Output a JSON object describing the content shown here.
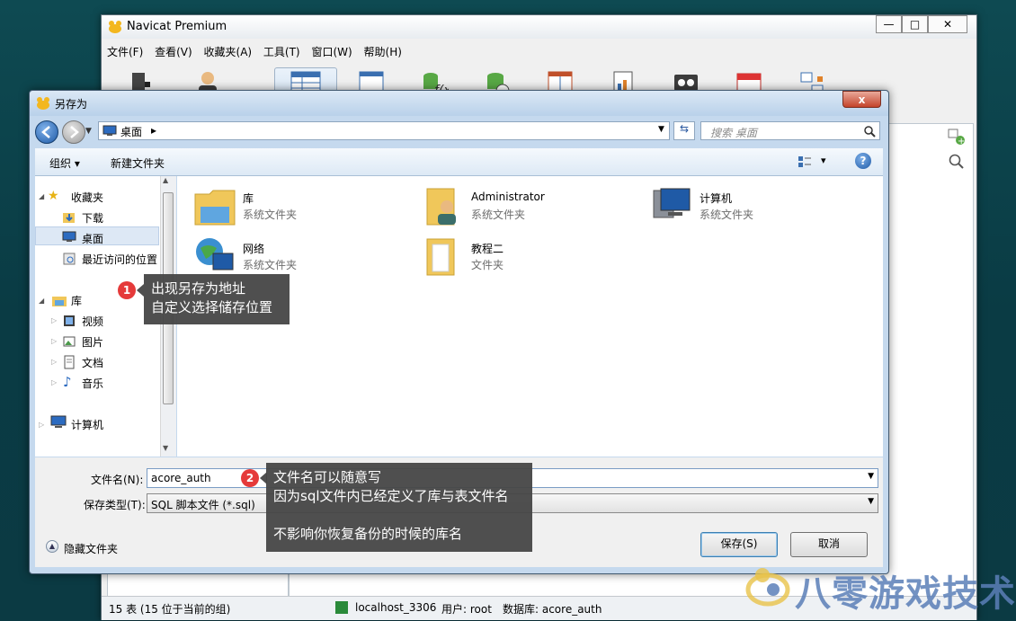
{
  "navicat": {
    "title": "Navicat Premium",
    "menu": [
      "文件(F)",
      "查看(V)",
      "收藏夹(A)",
      "工具(T)",
      "窗口(W)",
      "帮助(H)"
    ],
    "toolbar_labels": [
      "连接",
      "用户",
      "表",
      "视图",
      "函数",
      "事件",
      "查询",
      "报表",
      "备份",
      "计划",
      "模型"
    ],
    "side_items": [
      "localhost_3306",
      "acore_auth"
    ],
    "status": {
      "tables": "15 表 (15 位于当前的组)",
      "connection": "localhost_3306",
      "user": "用户: root",
      "database": "数据库: acore_auth"
    }
  },
  "dialog": {
    "title": "另存为",
    "close": "x",
    "address": {
      "location": "桌面",
      "arrow": "▸"
    },
    "search_placeholder": "搜索 桌面",
    "commands": {
      "organize": "组织 ▾",
      "new_folder": "新建文件夹",
      "view": "▾",
      "help": "?"
    },
    "tree": {
      "favorites": "收藏夹",
      "favorites_items": [
        "下载",
        "桌面",
        "最近访问的位置"
      ],
      "libraries": "库",
      "libraries_items": [
        "视频",
        "图片",
        "文档",
        "音乐"
      ],
      "computer": "计算机"
    },
    "files": [
      {
        "name": "库",
        "type": "系统文件夹"
      },
      {
        "name": "Administrator",
        "type": "系统文件夹"
      },
      {
        "name": "计算机",
        "type": "系统文件夹"
      },
      {
        "name": "网络",
        "type": "系统文件夹"
      },
      {
        "name": "教程二",
        "type": "文件夹"
      }
    ],
    "filename_label": "文件名(N):",
    "filename_value": "acore_auth",
    "filetype_label": "保存类型(T):",
    "filetype_value": "SQL 脚本文件 (*.sql)",
    "hide_folders": "隐藏文件夹",
    "save": "保存(S)",
    "cancel": "取消"
  },
  "annotations": {
    "one": {
      "num": "1",
      "line1": "出现另存为地址",
      "line2": "自定义选择储存位置"
    },
    "two": {
      "num": "2",
      "line1": "文件名可以随意写",
      "line2": "因为sql文件内已经定义了库与表文件名",
      "line3": "不影响你恢复备份的时候的库名"
    }
  },
  "watermark": "八零游戏技术",
  "colors": {
    "accent": "#3a7ecf",
    "badge": "#e53a3a",
    "tooltip": "#464646",
    "watermark": "#5b7fb8"
  }
}
